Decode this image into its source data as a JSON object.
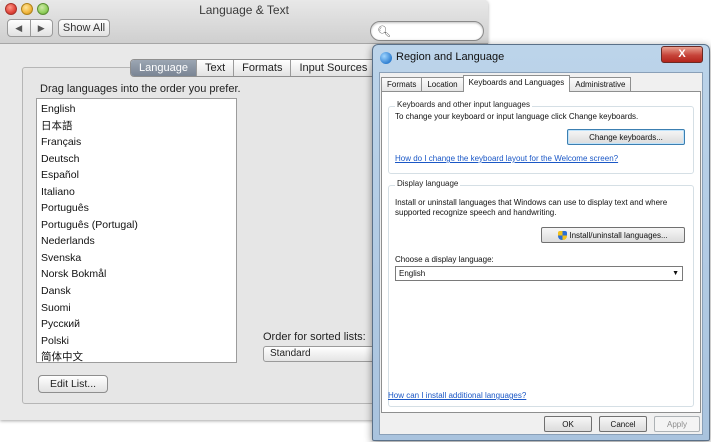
{
  "mac": {
    "title": "Language & Text",
    "nav_back": "◀",
    "nav_forward": "▶",
    "show_all": "Show All",
    "search_icon": "magnifier-icon",
    "tabs": [
      {
        "label": "Language"
      },
      {
        "label": "Text"
      },
      {
        "label": "Formats"
      },
      {
        "label": "Input Sources"
      }
    ],
    "drag_instruction": "Drag languages into the order you prefer.",
    "languages": [
      "English",
      "日本語",
      "Français",
      "Deutsch",
      "Español",
      "Italiano",
      "Português",
      "Português (Portugal)",
      "Nederlands",
      "Svenska",
      "Norsk Bokmål",
      "Dansk",
      "Suomi",
      "Русский",
      "Polski",
      "简体中文"
    ],
    "order_label": "Order for sorted lists:",
    "order_value": "Standard",
    "edit_list": "Edit List..."
  },
  "win": {
    "title": "Region and Language",
    "close": "X",
    "tabs": [
      {
        "label": "Formats"
      },
      {
        "label": "Location"
      },
      {
        "label": "Keyboards and Languages"
      },
      {
        "label": "Administrative"
      }
    ],
    "keyboards_group": "Keyboards and other input languages",
    "keyboards_text": "To change your keyboard or input language click Change keyboards.",
    "change_keyboards": "Change keyboards...",
    "keyboard_link": "How do I change the keyboard layout for the Welcome screen?",
    "display_group": "Display language",
    "display_text": "Install or uninstall languages that Windows can use to display text and where supported recognize speech and handwriting.",
    "install_button": "Install/uninstall languages...",
    "choose_label": "Choose a display language:",
    "display_value": "English",
    "additional_link": "How can I install additional languages?",
    "ok": "OK",
    "cancel": "Cancel",
    "apply": "Apply"
  }
}
